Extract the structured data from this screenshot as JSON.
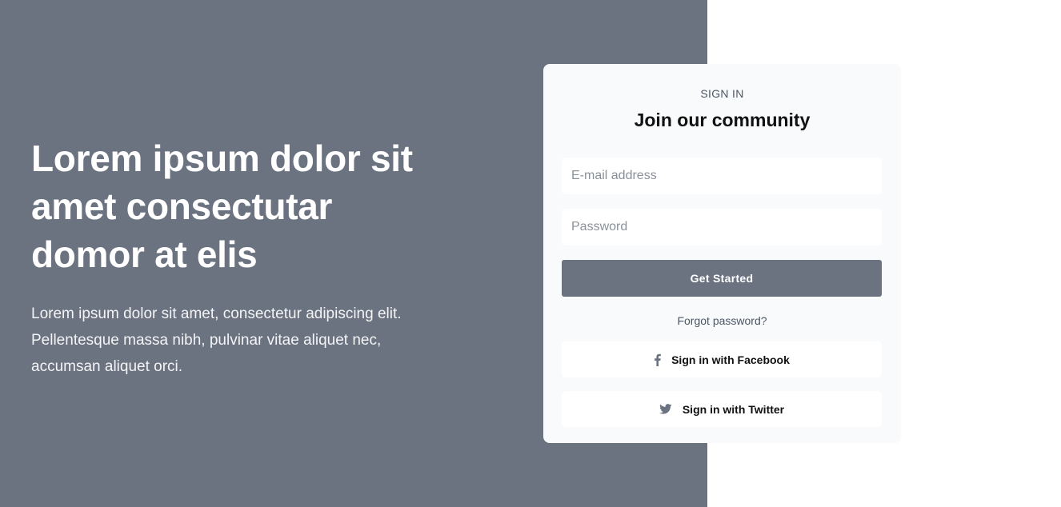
{
  "hero": {
    "heading": "Lorem ipsum dolor sit amet consectutar domor at elis",
    "paragraph": "Lorem ipsum dolor sit amet, consectetur adipiscing elit. Pellentesque massa nibh, pulvinar vitae aliquet nec, accumsan aliquet orci.",
    "background_color": "#6b7280"
  },
  "signin_card": {
    "eyebrow": "SIGN IN",
    "title": "Join our community",
    "email_placeholder": "E-mail address",
    "password_placeholder": "Password",
    "submit_label": "Get Started",
    "forgot_label": "Forgot password?",
    "facebook_label": "Sign in with Facebook",
    "facebook_icon": "facebook-icon",
    "twitter_label": "Sign in with Twitter",
    "twitter_icon": "twitter-icon",
    "accent_color": "#6b7280"
  }
}
